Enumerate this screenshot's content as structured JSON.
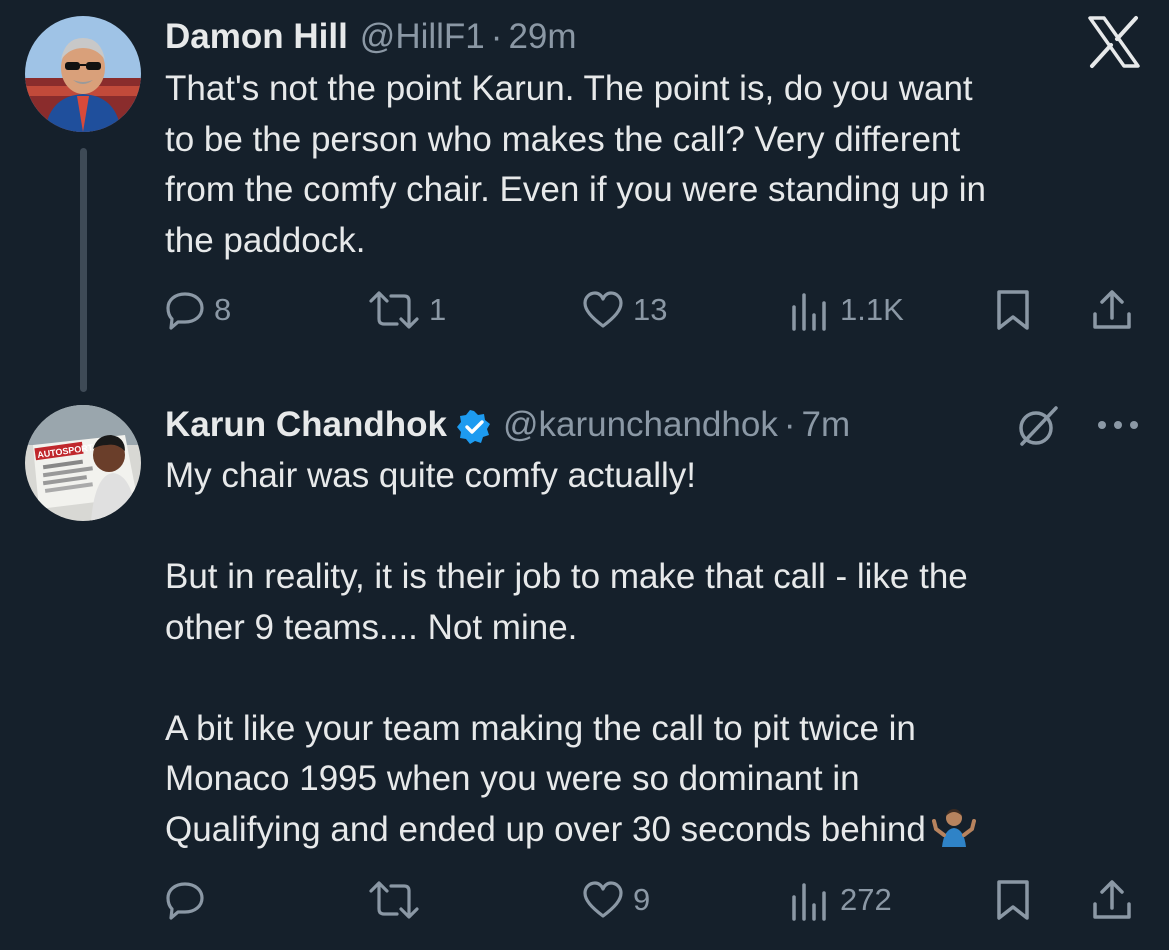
{
  "tweets": [
    {
      "author_name": "Damon Hill",
      "handle": "@HillF1",
      "separator": "·",
      "time": "29m",
      "text": "That's not the point Karun. The point is, do you want\nto be the person who makes the call? Very different\nfrom the comfy chair. Even if you were standing up in\nthe paddock.",
      "actions": {
        "replies": "8",
        "retweets": "1",
        "likes": "13",
        "views": "1.1K"
      }
    },
    {
      "author_name": "Karun Chandhok",
      "verified": true,
      "handle": "@karunchandhok",
      "separator": "·",
      "time": "7m",
      "text": "My chair was quite comfy actually!\n\nBut in reality, it is their job to make that call - like the\nother 9 teams.... Not mine.\n\nA bit like your team making the call to pit twice in\nMonaco 1995 when you were so dominant in\nQualifying and ended up over 30 seconds behind",
      "emoji": "person-shrugging",
      "actions": {
        "replies": "",
        "retweets": "",
        "likes": "9",
        "views": "272"
      },
      "avatar_badge_text": "AUTOSPORT"
    }
  ],
  "icons": {
    "brand": "x-logo",
    "grok": "grok-icon",
    "more": "more-icon",
    "reply": "reply-icon",
    "retweet": "retweet-icon",
    "like": "heart-icon",
    "views": "views-icon",
    "bookmark": "bookmark-icon",
    "share": "share-icon"
  },
  "colors": {
    "background": "#15202b",
    "text": "#e7e9ea",
    "secondary_text": "#8b98a5",
    "verified_blue": "#1d9bf0",
    "thread_line": "#3e4a56"
  }
}
